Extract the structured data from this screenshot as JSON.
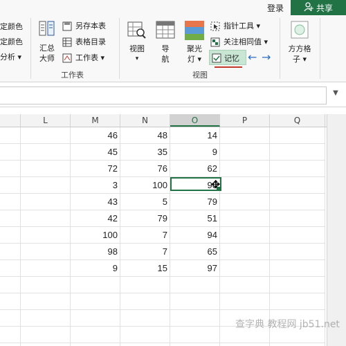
{
  "header": {
    "login_label": "登录",
    "share_label": "共享",
    "share_color": "#217346"
  },
  "ribbon": {
    "left_items": [
      "定颜色",
      "定颜色",
      "分析 ▾"
    ],
    "summary_label_1": "汇总",
    "summary_label_2": "大师",
    "worksheet_items": [
      "另存本表",
      "表格目录",
      "工作表 ▾"
    ],
    "worksheet_group": "工作表",
    "view_label": "视图",
    "view_arrow": "▾",
    "nav_label_1": "导",
    "nav_label_2": "航",
    "spotlight_label_1": "聚光",
    "spotlight_label_2": "灯 ▾",
    "pointer_tool": "指针工具 ▾",
    "follow_same": "关注相同值 ▾",
    "memory": "记忆",
    "view_group": "视图",
    "square_grid_1": "方方格",
    "square_grid_2": "子 ▾"
  },
  "columns": [
    "L",
    "M",
    "N",
    "O",
    "P",
    "Q"
  ],
  "selected_column": "O",
  "rows": [
    {
      "M": "46",
      "N": "48",
      "O": "14"
    },
    {
      "M": "45",
      "N": "35",
      "O": "9"
    },
    {
      "M": "72",
      "N": "76",
      "O": "62"
    },
    {
      "M": "3",
      "N": "100",
      "O": "90"
    },
    {
      "M": "43",
      "N": "5",
      "O": "79"
    },
    {
      "M": "42",
      "N": "79",
      "O": "51"
    },
    {
      "M": "100",
      "N": "7",
      "O": "94"
    },
    {
      "M": "98",
      "N": "7",
      "O": "65"
    },
    {
      "M": "9",
      "N": "15",
      "O": "97"
    }
  ],
  "watermark": "查字典 教程网 jb51.net",
  "icons": [
    "user-plus-icon",
    "summary-master-icon",
    "save-sheet-icon",
    "table-index-icon",
    "worksheet-icon",
    "view-icon",
    "navigation-icon",
    "spotlight-icon",
    "pointer-tool-icon",
    "follow-same-icon",
    "memory-icon",
    "back-arrow-icon",
    "forward-arrow-icon",
    "square-grid-icon",
    "chevron-down-icon"
  ]
}
